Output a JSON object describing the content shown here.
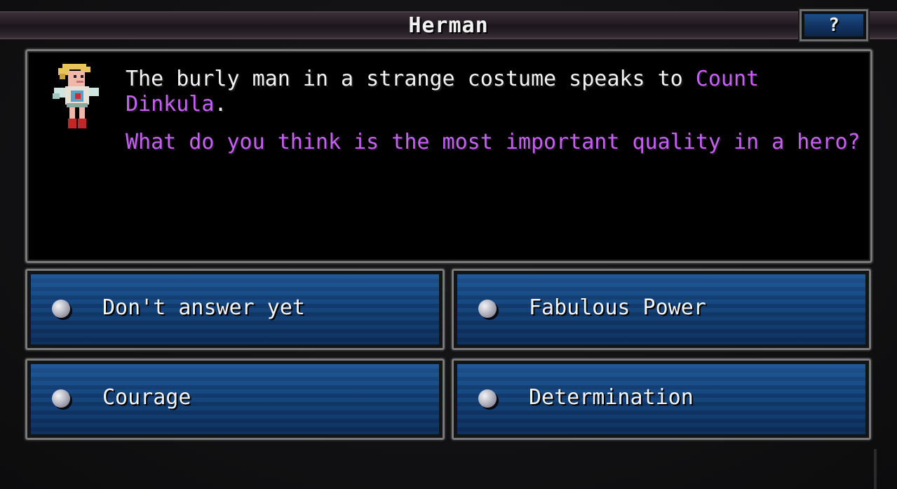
{
  "dialog": {
    "speaker_name": "Herman",
    "help_label": "?",
    "narration_prefix": "The burly man in a strange costume speaks to ",
    "narration_target": "Count Dinkula",
    "narration_suffix": ".",
    "question": "What do you think is the most important quality in a hero?",
    "portrait_icon": "herman-portrait-icon"
  },
  "choices": [
    {
      "label": "Don't answer yet",
      "icon": "bullet-icon"
    },
    {
      "label": "Fabulous Power",
      "icon": "bullet-icon"
    },
    {
      "label": "Courage",
      "icon": "bullet-icon"
    },
    {
      "label": "Determination",
      "icon": "bullet-icon"
    }
  ],
  "colors": {
    "highlight": "#c560f2",
    "text": "#f2f2f2",
    "choice_fill": "#174a82",
    "panel_border": "#7a7a7a"
  }
}
